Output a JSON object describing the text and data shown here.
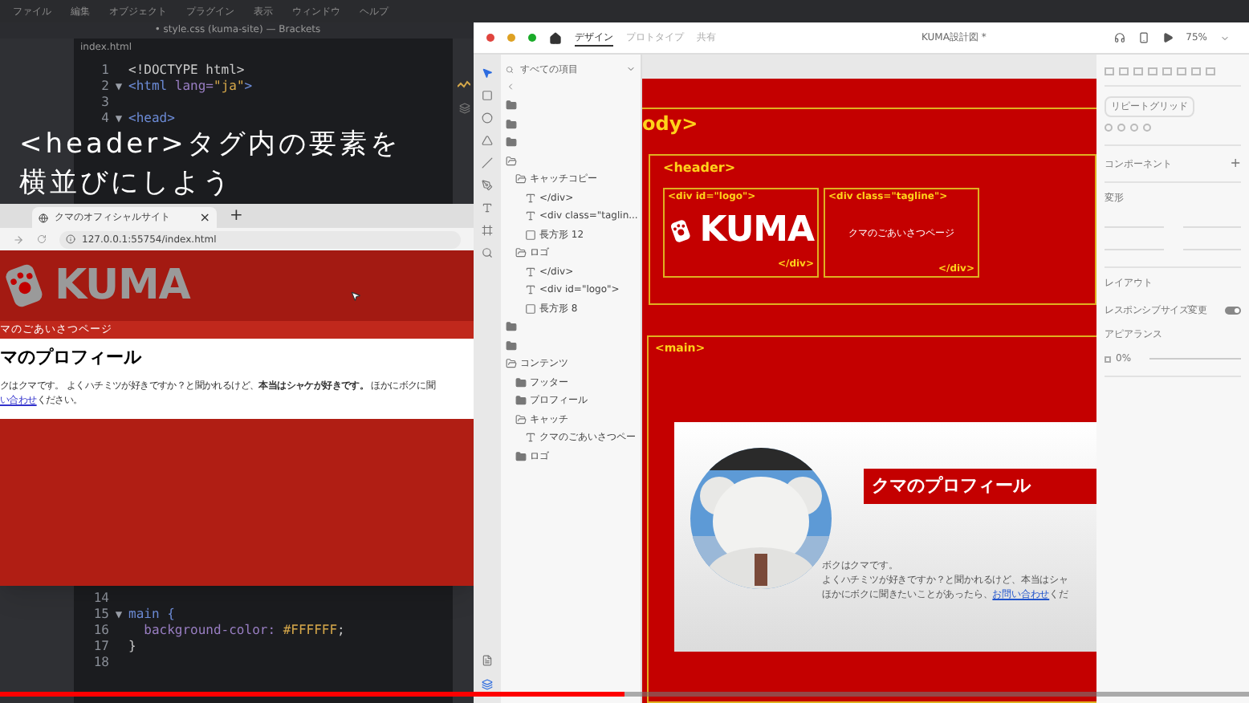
{
  "menu_bar": {
    "items": [
      "ファイル",
      "編集",
      "オブジェクト",
      "プラグイン",
      "表示",
      "ウィンドウ",
      "ヘルプ"
    ]
  },
  "editor": {
    "title": "• style.css (kuma-site) — Brackets",
    "tab": "index.html",
    "lines_top": [
      {
        "number": "1",
        "tokens": [
          {
            "text": "<!DOCTYPE html>",
            "kind": "plain"
          }
        ]
      },
      {
        "number": "2",
        "fold": "▼",
        "tokens": [
          {
            "text": "<html ",
            "kind": "tag"
          },
          {
            "text": "lang=",
            "kind": "attr"
          },
          {
            "text": "\"ja\"",
            "kind": "string"
          },
          {
            "text": ">",
            "kind": "tag"
          }
        ]
      },
      {
        "number": "3"
      },
      {
        "number": "4",
        "fold": "▼",
        "tokens": [
          {
            "text": "<head>",
            "kind": "tag"
          }
        ]
      }
    ],
    "lines_bottom": [
      {
        "number": "14"
      },
      {
        "number": "15",
        "fold": "▼",
        "tokens": [
          {
            "text": "main {",
            "kind": "tag"
          }
        ]
      },
      {
        "number": "16",
        "tokens": [
          {
            "text": "  background-color: ",
            "kind": "attr"
          },
          {
            "text": "#FFFFFF",
            "kind": "string"
          },
          {
            "text": ";",
            "kind": "plain"
          }
        ]
      },
      {
        "number": "17",
        "tokens": [
          {
            "text": "}",
            "kind": "plain"
          }
        ]
      },
      {
        "number": "18"
      }
    ]
  },
  "caption": {
    "lines": [
      "<header>タグ内の要素を",
      "横並びにしよう"
    ]
  },
  "browser": {
    "tab": "クマのオフィシャルサイト",
    "close": "×",
    "new_tab": "+",
    "url": "127.0.0.1:55754/index.html",
    "site": {
      "logo": "KUMA",
      "tagline": "マのごあいさつページ",
      "heading": "マのプロフィール",
      "paragraph": "クはクマです。 よくハチミツが好きですか？と聞かれるけど、**本当はシャケが好きです。** ほかにボクに聞",
      "link": "い合わせ",
      "after_link": "ください。"
    }
  },
  "xd": {
    "tabs": [
      {
        "label": "デザイン",
        "selected": true
      },
      {
        "label": "プロトタイプ",
        "selected": false
      },
      {
        "label": "共有",
        "selected": false
      }
    ],
    "document_title": "KUMA設計図 *",
    "zoom": "75%",
    "layers": {
      "search": "すべての項目",
      "items": [
        {
          "kind": "folder"
        },
        {
          "kind": "folder"
        },
        {
          "kind": "folder"
        },
        {
          "kind": "group",
          "children": [
            {
              "label": "キャッチコピー",
              "kind": "group",
              "children": [
                {
                  "label": "</div>",
                  "kind": "text"
                },
                {
                  "label": "<div class=\"taglin...",
                  "kind": "text"
                },
                {
                  "label": "長方形 12",
                  "kind": "rect"
                }
              ]
            },
            {
              "label": "ロゴ",
              "kind": "group",
              "children": [
                {
                  "label": "</div>",
                  "kind": "text"
                },
                {
                  "label": "<div id=\"logo\">",
                  "kind": "text"
                },
                {
                  "label": "長方形 8",
                  "kind": "rect"
                }
              ]
            }
          ]
        },
        {
          "kind": "folder"
        },
        {
          "kind": "folder"
        },
        {
          "label": "コンテンツ",
          "kind": "group",
          "children": [
            {
              "label": "フッター",
              "kind": "folder"
            },
            {
              "label": "プロフィール",
              "kind": "folder"
            },
            {
              "label": "キャッチ",
              "kind": "group",
              "children": [
                {
                  "label": "クマのごあいさつペー",
                  "kind": "text"
                }
              ]
            },
            {
              "label": "ロゴ",
              "kind": "folder"
            }
          ]
        }
      ]
    },
    "canvas": {
      "body_tag": "ody>",
      "header_tag": "<header>",
      "logo_open": "<div id=\"logo\">",
      "logo": "KUMA",
      "logo_close": "</div>",
      "tagline_open": "<div class=\"tagline\">",
      "tagline": "クマのごあいさつページ",
      "tagline_close": "</div>",
      "main_tag": "<main>",
      "profile": {
        "heading": "クマのプロフィール",
        "lines": [
          "ボクはクマです。",
          "よくハチミツが好きですか？と聞かれるけど、本当はシャ"
        ],
        "last_line": "ほかにボクに聞きたいことがあったら、",
        "link": "お問い合わせ",
        "after_link": "くだ"
      }
    },
    "properties": {
      "repeat_grid": "リピートグリッド",
      "component": "コンポーネント",
      "add": "+",
      "transform": "変形",
      "layout": "レイアウト",
      "responsive": {
        "label": "レスポンシブサイズ変更",
        "on": true
      },
      "appearance": "アピアランス",
      "opacity": "0%"
    }
  },
  "video": {
    "level": 0.5
  }
}
